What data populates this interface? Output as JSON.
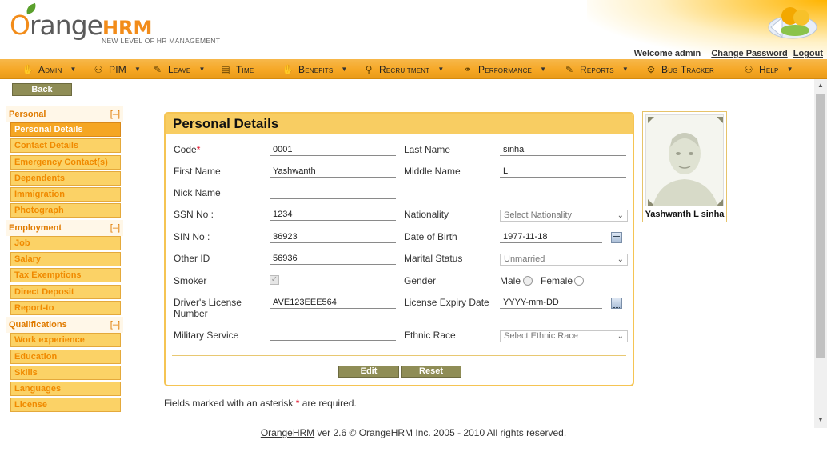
{
  "header": {
    "logo_word": "range",
    "logo_initial": "O",
    "logo_hrm": "HRM",
    "tagline": "NEW LEVEL OF HR MANAGEMENT",
    "welcome": "Welcome admin",
    "change_password": "Change Password",
    "logout": "Logout"
  },
  "menu": {
    "items": [
      {
        "label": "Admin",
        "icon": "admin-icon"
      },
      {
        "label": "PIM",
        "icon": "pim-icon"
      },
      {
        "label": "Leave",
        "icon": "leave-icon"
      },
      {
        "label": "Time",
        "icon": "time-icon"
      },
      {
        "label": "Benefits",
        "icon": "benefits-icon"
      },
      {
        "label": "Recruitment",
        "icon": "recruitment-icon"
      },
      {
        "label": "Performance",
        "icon": "performance-icon"
      },
      {
        "label": "Reports",
        "icon": "reports-icon"
      },
      {
        "label": "Bug Tracker",
        "icon": "bug-tracker-icon"
      },
      {
        "label": "Help",
        "icon": "help-icon"
      }
    ]
  },
  "back_label": "Back",
  "sidebar": {
    "toggle": "[–]",
    "sections": [
      {
        "title": "Personal",
        "items": [
          "Personal Details",
          "Contact Details",
          "Emergency Contact(s)",
          "Dependents",
          "Immigration",
          "Photograph"
        ]
      },
      {
        "title": "Employment",
        "items": [
          "Job",
          "Salary",
          "Tax Exemptions",
          "Direct Deposit",
          "Report-to"
        ]
      },
      {
        "title": "Qualifications",
        "items": [
          "Work experience",
          "Education",
          "Skills",
          "Languages",
          "License"
        ]
      }
    ]
  },
  "panel": {
    "title": "Personal Details",
    "labels": {
      "code": "Code",
      "last_name": "Last Name",
      "first_name": "First Name",
      "middle_name": "Middle Name",
      "nick_name": "Nick Name",
      "ssn": "SSN No :",
      "nationality": "Nationality",
      "sin": "SIN No :",
      "dob": "Date of Birth",
      "other_id": "Other ID",
      "marital": "Marital Status",
      "smoker": "Smoker",
      "gender": "Gender",
      "dl_line1": "Driver's License",
      "dl_line2": "Number",
      "license_expiry": "License Expiry Date",
      "military": "Military Service",
      "ethnic": "Ethnic Race",
      "male": "Male",
      "female": "Female",
      "asterisk": "*"
    },
    "values": {
      "code": "0001",
      "last_name": "sinha",
      "first_name": "Yashwanth",
      "middle_name": "L",
      "nick_name": "",
      "ssn": "1234",
      "nationality": "Select Nationality",
      "sin": "36923",
      "dob": "1977-11-18",
      "other_id": "56936",
      "marital": "Unmarried",
      "dl_number": "AVE123EEE564",
      "license_expiry": "YYYY-mm-DD",
      "military": "",
      "ethnic": "Select Ethnic Race"
    },
    "edit_label": "Edit",
    "reset_label": "Reset"
  },
  "required_note": {
    "before": "Fields marked with an asterisk ",
    "asterisk": "*",
    "after": " are required."
  },
  "photo": {
    "name": "Yashwanth L sinha"
  },
  "footer": {
    "brand": "OrangeHRM",
    "text": " ver 2.6 © OrangeHRM Inc. 2005 - 2010 All rights reserved."
  }
}
